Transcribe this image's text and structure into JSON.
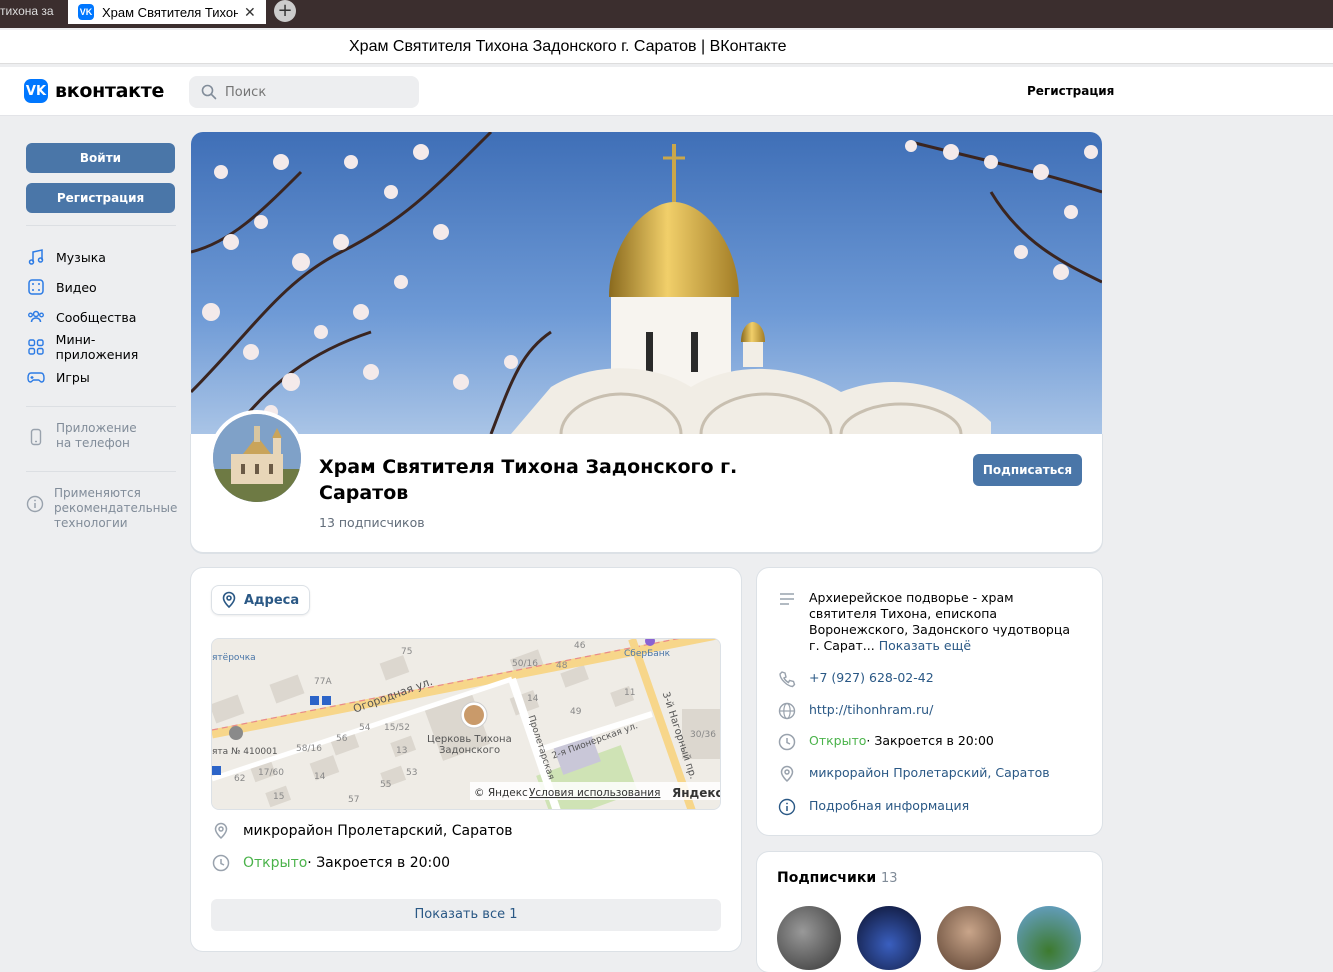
{
  "browser": {
    "inactive_tab": "тихона за",
    "active_tab": "Храм Святителя Тихона Задонского г. Саратов | ВКонтакте",
    "active_tab_short": "Храм Святителя Тихон",
    "window_title": "Храм Святителя Тихона Задонского г. Саратов | ВКонтакте",
    "new_tab_symbol": "+",
    "close_symbol": "✕"
  },
  "header": {
    "logo_mark": "VK",
    "logo_text": "вконтакте",
    "search_placeholder": "Поиск",
    "register_link": "Регистрация"
  },
  "sidebar": {
    "login_button": "Войти",
    "register_button": "Регистрация",
    "items": [
      {
        "label": "Музыка",
        "icon": "music-icon"
      },
      {
        "label": "Видео",
        "icon": "video-icon"
      },
      {
        "label": "Сообщества",
        "icon": "communities-icon"
      },
      {
        "label": "Мини-приложения",
        "icon": "mini-apps-icon"
      },
      {
        "label": "Игры",
        "icon": "games-icon"
      }
    ],
    "app_label_1": "Приложение",
    "app_label_2": "на телефон",
    "tech_label_1": "Применяются",
    "tech_label_2": "рекомендательные",
    "tech_label_3": "технологии"
  },
  "group": {
    "name_line1": "Храм Святителя Тихона Задонского г.",
    "name_line2": "Саратов",
    "subscribers": "13 подписчиков",
    "subscribe_button": "Подписаться"
  },
  "addresses": {
    "chip_label": "Адреса",
    "address": "микрорайон Пролетарский, Саратов",
    "status_open": "Открыто",
    "status_rest": " · Закроется в 20:00",
    "show_all": "Показать все 1",
    "map": {
      "streets": [
        "Огородная ул.",
        "Пролетарская",
        "2-я Пионерская ул.",
        "3-й Нагорный пр."
      ],
      "place": "Церковь Тихона Задонского",
      "place_line1": "Церковь Тихона",
      "place_line2": "Задонского",
      "pois": [
        "ятёрочка",
        "СберБанк",
        "ята № 410001"
      ],
      "houses": [
        "75",
        "77А",
        "46",
        "50/16",
        "48",
        "14",
        "11",
        "49",
        "54",
        "15/52",
        "56",
        "58/16",
        "13",
        "30/36",
        "62",
        "17/60",
        "14",
        "53",
        "55",
        "15",
        "57"
      ],
      "copyright": "© Яндекс",
      "terms": "Условия использования",
      "brand": "Яндекс"
    }
  },
  "info": {
    "description": "Архиерейское подворье - храм святителя Тихона, епископа Воронежского, Задонского чудотворца г. Сарат...",
    "show_more": "Показать ещё",
    "phone": "+7 (927) 628-02-42",
    "website": "http://tihonhram.ru/",
    "status_open": "Открыто",
    "status_rest": " · Закроется в 20:00",
    "address": "микрорайон Пролетарский, Саратов",
    "details": "Подробная информация"
  },
  "followers": {
    "title": "Подписчики",
    "count": "13"
  },
  "colors": {
    "accent": "#4a76a8",
    "link": "#2a5885",
    "open_green": "#4bb34b",
    "vk_blue": "#0077ff"
  }
}
